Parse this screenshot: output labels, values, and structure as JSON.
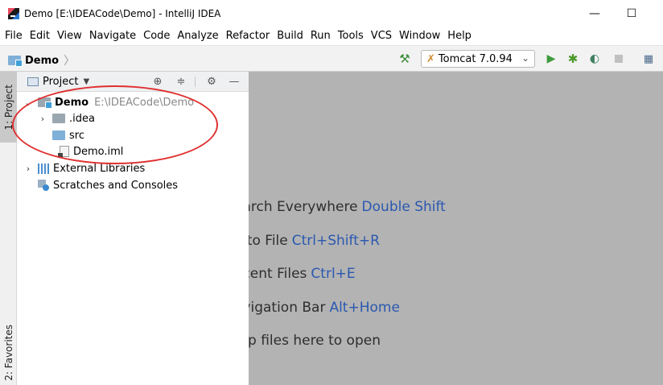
{
  "window": {
    "title": "Demo [E:\\IDEACode\\Demo] - IntelliJ IDEA",
    "minimize_glyph": "—",
    "maximize_glyph": "☐"
  },
  "menu": [
    "File",
    "Edit",
    "View",
    "Navigate",
    "Code",
    "Analyze",
    "Refactor",
    "Build",
    "Run",
    "Tools",
    "VCS",
    "Window",
    "Help"
  ],
  "navbar": {
    "breadcrumb": "Demo",
    "run_config": "Tomcat 7.0.94"
  },
  "side_tabs": {
    "project": "1: Project",
    "favorites": "2: Favorites"
  },
  "project_panel": {
    "view_label": "Project",
    "tree": {
      "root_name": "Demo",
      "root_path": "E:\\IDEACode\\Demo",
      "idea": ".idea",
      "src": "src",
      "iml": "Demo.iml",
      "libraries": "External Libraries",
      "scratches": "Scratches and Consoles"
    }
  },
  "editor_hints": [
    {
      "text": "earch Everywhere",
      "shortcut": "Double Shift"
    },
    {
      "text": "o to File",
      "shortcut": "Ctrl+Shift+R"
    },
    {
      "text": "ecent Files",
      "shortcut": "Ctrl+E"
    },
    {
      "text": "avigation Bar",
      "shortcut": "Alt+Home"
    },
    {
      "text": "rop files here to open",
      "shortcut": ""
    }
  ],
  "annotation": {
    "color": "#e03030"
  }
}
